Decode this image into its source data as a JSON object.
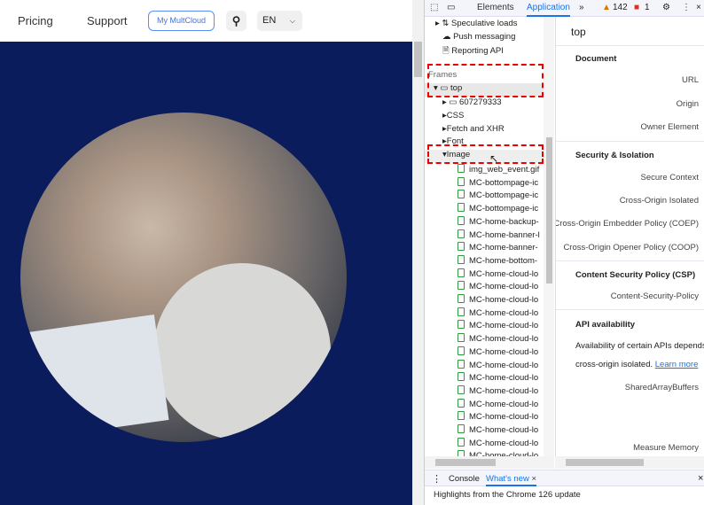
{
  "website": {
    "nav": [
      "Pricing",
      "Support"
    ],
    "my_multcloud": "My MultCloud",
    "language": "EN"
  },
  "devtools": {
    "toolbar": {
      "tabs": [
        "Elements",
        "Application"
      ],
      "active_tab": "Application",
      "warnings": "142",
      "errors": "1"
    },
    "tree": {
      "top_items": [
        "Speculative loads",
        "Push messaging",
        "Reporting API"
      ],
      "frames_label": "Frames",
      "frame": "top",
      "children": [
        "607279333",
        "CSS",
        "Fetch and XHR",
        "Font",
        "Image"
      ],
      "images": [
        "img_web_event.gif",
        "MC-bottompage-ic",
        "MC-bottompage-ic",
        "MC-bottompage-ic",
        "MC-home-backup-",
        "MC-home-banner-l",
        "MC-home-banner-",
        "MC-home-bottom-",
        "MC-home-cloud-lo",
        "MC-home-cloud-lo",
        "MC-home-cloud-lo",
        "MC-home-cloud-lo",
        "MC-home-cloud-lo",
        "MC-home-cloud-lo",
        "MC-home-cloud-lo",
        "MC-home-cloud-lo",
        "MC-home-cloud-lo",
        "MC-home-cloud-lo",
        "MC-home-cloud-lo",
        "MC-home-cloud-lo",
        "MC-home-cloud-lo",
        "MC-home-cloud-lo",
        "MC-home-cloud-lo"
      ]
    },
    "detail": {
      "title": "top",
      "document": "Document",
      "url": "URL",
      "origin": "Origin",
      "owner": "Owner Element",
      "security": "Security & Isolation",
      "secure": "Secure Context",
      "coi": "Cross-Origin Isolated",
      "coep": "Cross-Origin Embedder Policy (COEP)",
      "coop": "Cross-Origin Opener Policy (COOP)",
      "csp": "Content Security Policy (CSP)",
      "csp_field": "Content-Security-Policy",
      "api": "API availability",
      "api_text": "Availability of certain APIs depends",
      "api_text2": "cross-origin isolated.",
      "learn_more": "Learn more",
      "sab": "SharedArrayBuffers",
      "mm": "Measure Memory"
    },
    "drawer": {
      "tabs": [
        "Console",
        "What's new"
      ],
      "active": "What's new",
      "message": "Highlights from the Chrome 126 update"
    }
  },
  "colors": {
    "accent": "#1a73e8",
    "highlight": "#e00000",
    "navy": "#0b1c5c"
  }
}
